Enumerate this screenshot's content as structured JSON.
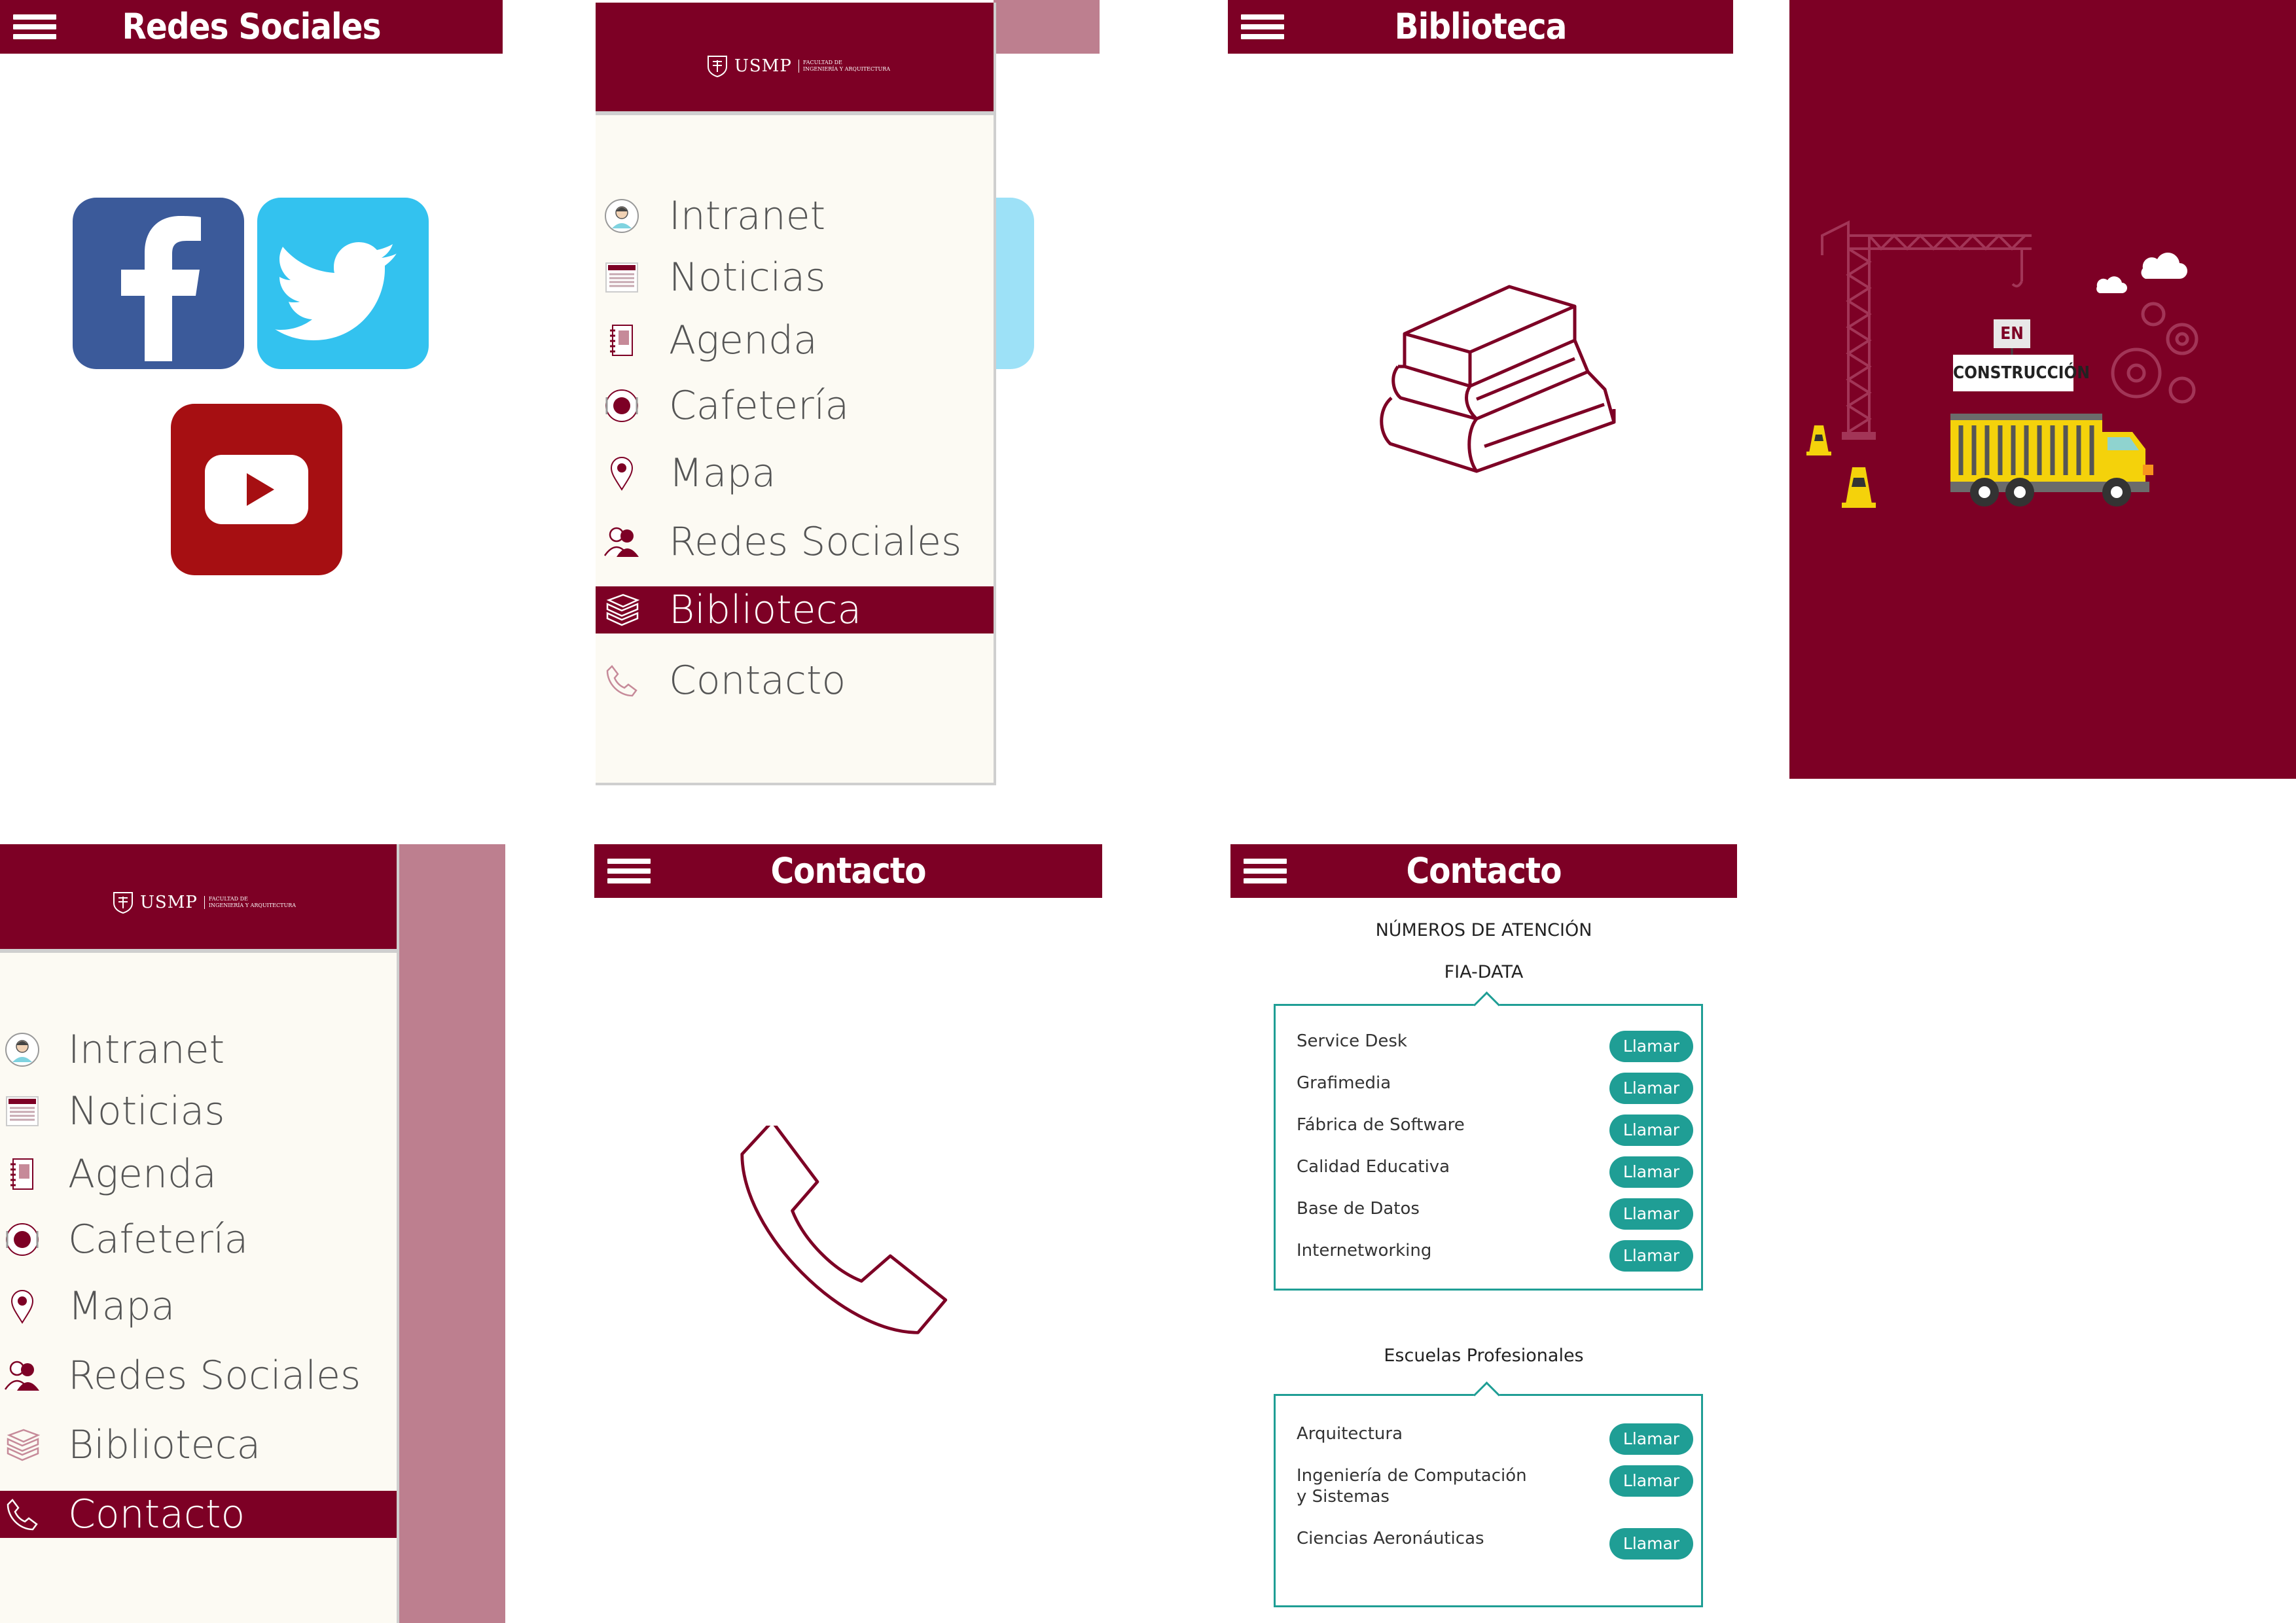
{
  "colors": {
    "brand": "#7d0025",
    "brand_light": "#bd7f8f",
    "teal": "#1f9e95",
    "drawer_bg": "#fcfaf3"
  },
  "screen_redes": {
    "title": "Redes Sociales",
    "icons": [
      "facebook-icon",
      "twitter-icon",
      "youtube-icon"
    ]
  },
  "drawer": {
    "logo_text": "USMP",
    "logo_sub_1": "FACULTAD DE",
    "logo_sub_2": "INGENIERÍA Y ARQUITECTURA",
    "items": [
      {
        "label": "Intranet",
        "icon": "user-avatar-icon"
      },
      {
        "label": "Noticias",
        "icon": "newspaper-icon"
      },
      {
        "label": "Agenda",
        "icon": "notebook-icon"
      },
      {
        "label": "Cafetería",
        "icon": "plate-icon"
      },
      {
        "label": "Mapa",
        "icon": "map-pin-icon"
      },
      {
        "label": "Redes Sociales",
        "icon": "people-icon"
      },
      {
        "label": "Biblioteca",
        "icon": "books-icon"
      },
      {
        "label": "Contacto",
        "icon": "phone-icon"
      }
    ],
    "active_top": "Biblioteca",
    "active_bottom": "Contacto"
  },
  "screen_biblioteca": {
    "title": "Biblioteca",
    "icon": "books-icon"
  },
  "screen_construccion": {
    "line1": "EN",
    "line2": "CONSTRUCCIÓN"
  },
  "screen_contacto_icon": {
    "title": "Contacto",
    "icon": "phone-icon"
  },
  "screen_contacto": {
    "title": "Contacto",
    "heading": "NÚMEROS DE ATENCIÓN",
    "group1_title": "FIA-DATA",
    "group1": [
      {
        "label": "Service Desk",
        "button": "Llamar"
      },
      {
        "label": "Grafimedia",
        "button": "Llamar"
      },
      {
        "label": "Fábrica de Software",
        "button": "Llamar"
      },
      {
        "label": "Calidad Educativa",
        "button": "Llamar"
      },
      {
        "label": "Base de Datos",
        "button": "Llamar"
      },
      {
        "label": "Internetworking",
        "button": "Llamar"
      }
    ],
    "group2_title": "Escuelas Profesionales",
    "group2": [
      {
        "label": "Arquitectura",
        "button": "Llamar"
      },
      {
        "label_line1": "Ingeniería de Computación",
        "label_line2": "y Sistemas",
        "button": "Llamar"
      },
      {
        "label": "Ciencias Aeronáuticas",
        "button": "Llamar"
      }
    ]
  }
}
